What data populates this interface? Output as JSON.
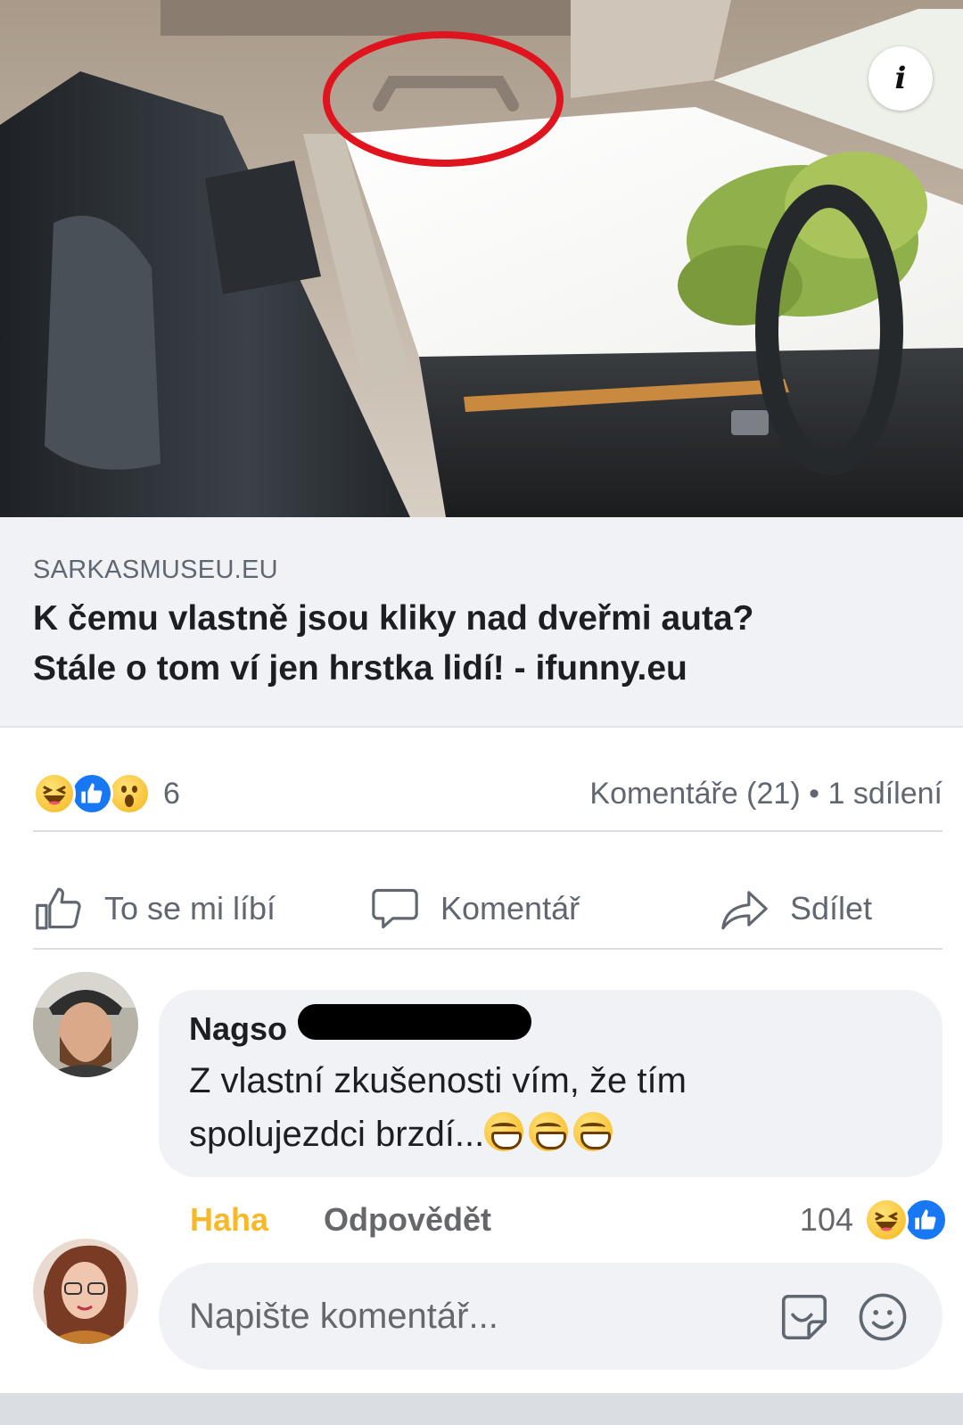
{
  "post": {
    "link": {
      "domain": "SARKASMUSEU.EU",
      "title_line1": "K čemu vlastně jsou kliky nad dveřmi auta?",
      "title_line2": "Stále o tom ví jen hrstka lidí! - ifunny.eu"
    },
    "reactions": {
      "icons": [
        "haha-reaction-icon",
        "like-reaction-icon",
        "wow-reaction-icon"
      ],
      "count": "6"
    },
    "stats": {
      "comments": "Komentáře (21)",
      "separator": "•",
      "shares": "1 sdílení"
    },
    "actions": {
      "like": "To se mi líbí",
      "comment": "Komentář",
      "share": "Sdílet"
    }
  },
  "comment": {
    "author": "Nagso",
    "text_line1": "Z vlastní zkušenosti vím, že tím",
    "text_line2": "spolujezdci brzdí...",
    "emoji": "grinning-face-emoji",
    "reaction_label": "Haha",
    "reply_label": "Odpovědět",
    "reaction_count": "104"
  },
  "composer": {
    "placeholder": "Napište komentář...",
    "icons": [
      "sticker-icon",
      "emoji-icon"
    ]
  },
  "colors": {
    "link_bg": "#f0f2f5",
    "like_blue": "#1877f2",
    "haha_yellow": "#f7b928",
    "muted_text": "#606770",
    "annotation_red": "#e0141e"
  }
}
